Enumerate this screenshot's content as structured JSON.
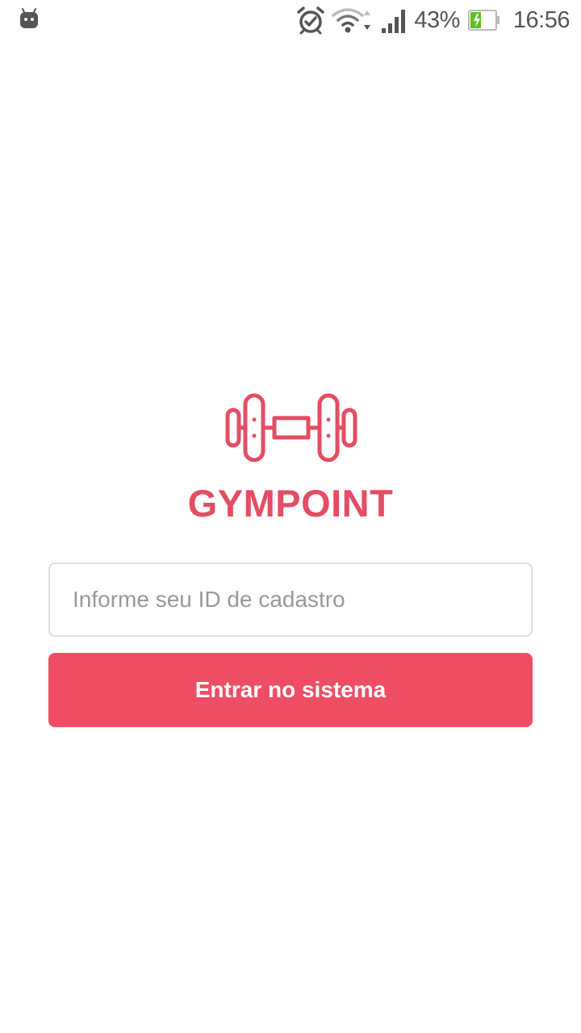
{
  "status_bar": {
    "battery_percent": "43%",
    "battery_level": 0.43,
    "time": "16:56",
    "icons": {
      "notification": "android-icon",
      "alarm": "alarm-clock-icon",
      "wifi": "wifi-icon",
      "signal": "cell-signal-icon",
      "battery": "battery-charging-icon"
    }
  },
  "brand": {
    "logo": "dumbbell-icon",
    "title": "GYMPOINT",
    "color": "#E44D63"
  },
  "login": {
    "id_placeholder": "Informe seu ID de cadastro",
    "id_value": "",
    "submit_label": "Entrar no sistema",
    "button_color": "#EE4D64"
  }
}
